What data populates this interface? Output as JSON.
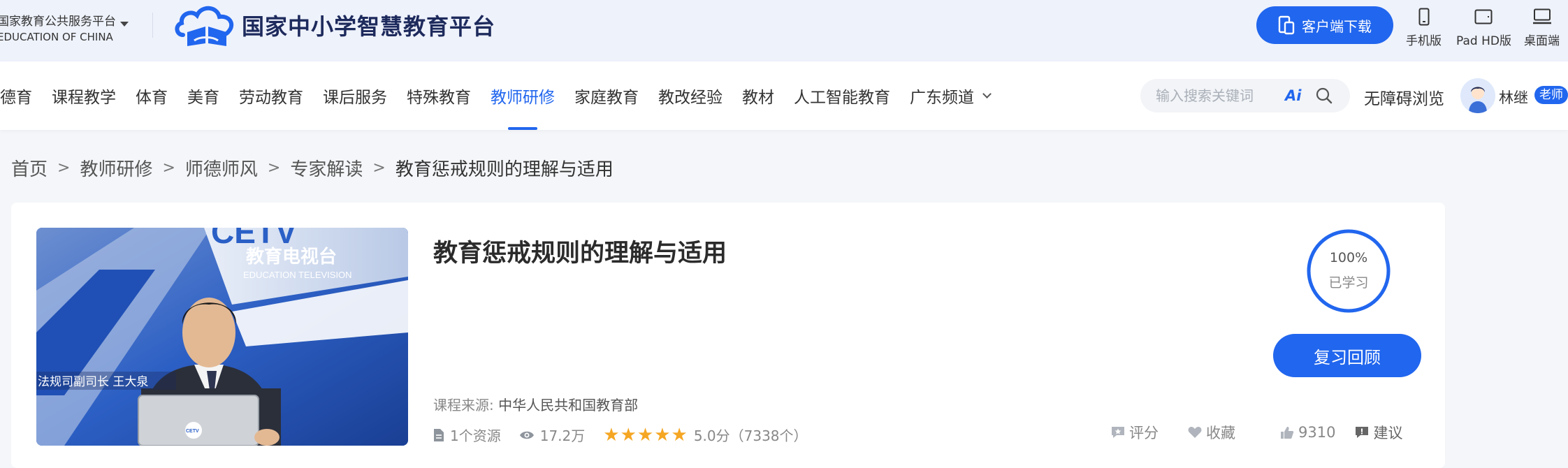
{
  "header": {
    "platform_cn": "国家教育公共服务平台",
    "platform_en": "EDUCATION OF CHINA",
    "logo_title": "国家中小学智慧教育平台",
    "download_label": "客户端下载",
    "devices": [
      {
        "label": "手机版",
        "icon": "phone-icon"
      },
      {
        "label": "Pad HD版",
        "icon": "tablet-icon"
      },
      {
        "label": "桌面端",
        "icon": "desktop-icon"
      }
    ],
    "accent_color": "#2166ee"
  },
  "nav": {
    "items": [
      {
        "label": "德育"
      },
      {
        "label": "课程教学"
      },
      {
        "label": "体育"
      },
      {
        "label": "美育"
      },
      {
        "label": "劳动教育"
      },
      {
        "label": "课后服务"
      },
      {
        "label": "特殊教育"
      },
      {
        "label": "教师研修",
        "active": true
      },
      {
        "label": "家庭教育"
      },
      {
        "label": "教改经验"
      },
      {
        "label": "教材"
      },
      {
        "label": "人工智能教育"
      },
      {
        "label": "广东频道",
        "dropdown": true
      }
    ],
    "search_placeholder": "输入搜索关键词",
    "ai_label": "Ai",
    "accessibility_label": "无障碍浏览",
    "user_name": "林继",
    "user_role": "老师"
  },
  "breadcrumb": {
    "items": [
      "首页",
      "教师研修",
      "师德师风",
      "专家解读"
    ],
    "separator": ">",
    "current": "教育惩戒规则的理解与适用"
  },
  "course": {
    "title": "教育惩戒规则的理解与适用",
    "source_label": "课程来源:",
    "source_value": "中华人民共和国教育部",
    "resources": "1个资源",
    "views": "17.2万",
    "rating_stars": 5,
    "rating_text": "5.0分（7338个）",
    "progress_percent": 100,
    "progress_text": "100%",
    "progress_label": "已学习",
    "review_button": "复习回顾",
    "actions": {
      "rate": "评分",
      "favorite": "收藏",
      "likes": "9310",
      "suggest": "建议"
    }
  },
  "thumbnail": {
    "channel_logo": "CETV",
    "channel_name": "教育电视台",
    "channel_en": "EDUCATION TELEVISION",
    "caption": "法规司副司长  王大泉",
    "laptop_logo": "CETV"
  }
}
